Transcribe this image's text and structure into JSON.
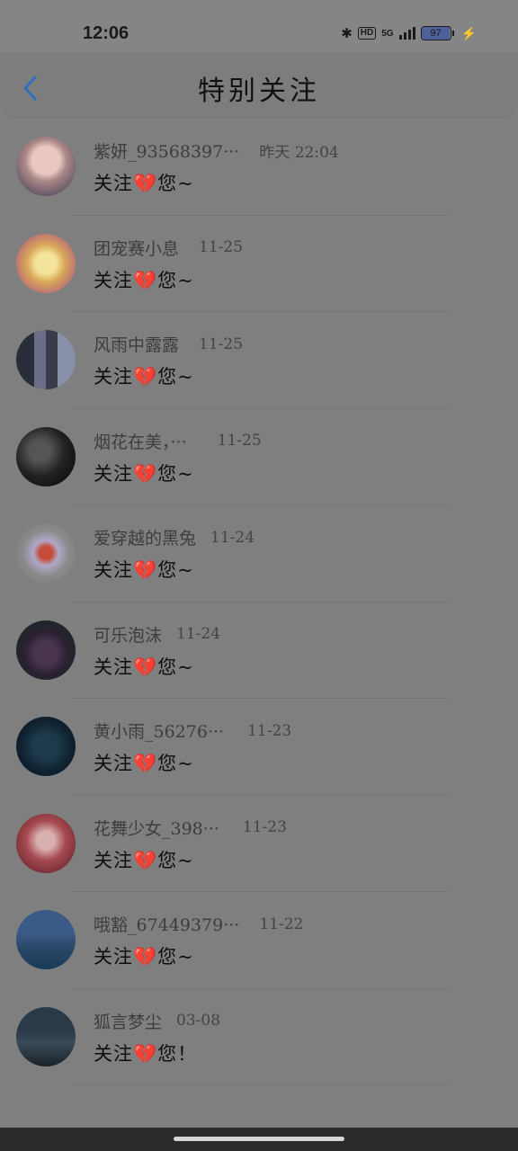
{
  "status_bar": {
    "time": "12:06",
    "hd": "HD",
    "network": "5G",
    "battery": "97",
    "battery_level": 0.97,
    "icons": [
      "bluetooth-icon",
      "hd-icon",
      "signal-5g-icon",
      "battery-icon",
      "charging-bolt-icon"
    ]
  },
  "header": {
    "title": "特别关注",
    "back_icon": "chevron-left-icon",
    "accent_color": "#2f6fbf"
  },
  "items": [
    {
      "name": "紫妍_93568397···",
      "time": "昨天 22:04",
      "message": "关注💔您~"
    },
    {
      "name": "团宠赛小息",
      "time": "11-25",
      "message": "关注💔您~"
    },
    {
      "name": "风雨中露露",
      "time": "11-25",
      "message": "关注💔您~"
    },
    {
      "name": "烟花在美，···",
      "time": "11-25",
      "message": "关注💔您~"
    },
    {
      "name": "爱穿越的黑兔",
      "time": "11-24",
      "message": "关注💔您~"
    },
    {
      "name": "可乐泡沫",
      "time": "11-24",
      "message": "关注💔您~"
    },
    {
      "name": "黄小雨_56276···",
      "time": "11-23",
      "message": "关注💔您~"
    },
    {
      "name": "花舞少女_398···",
      "time": "11-23",
      "message": "关注💔您~"
    },
    {
      "name": "哦豁_67449379···",
      "time": "11-22",
      "message": "关注💔您~"
    },
    {
      "name": "狐言梦尘",
      "time": "03-08",
      "message": "关注💔您！"
    }
  ]
}
